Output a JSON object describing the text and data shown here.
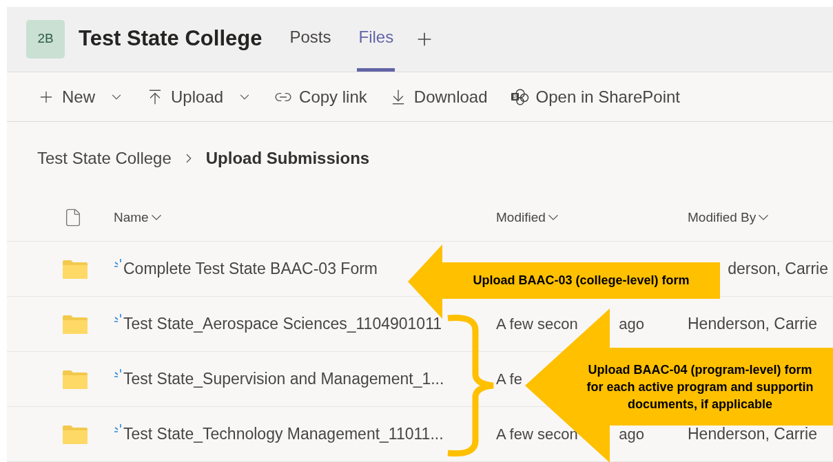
{
  "team": {
    "avatar": "2B",
    "name": "Test State College"
  },
  "tabs": [
    {
      "label": "Posts",
      "selected": false
    },
    {
      "label": "Files",
      "selected": true
    }
  ],
  "toolbar": [
    {
      "label": "New",
      "kind": "plus",
      "dropdown": true
    },
    {
      "label": "Upload",
      "kind": "upload",
      "dropdown": true
    },
    {
      "label": "Copy link",
      "kind": "link",
      "dropdown": false
    },
    {
      "label": "Download",
      "kind": "download",
      "dropdown": false
    },
    {
      "label": "Open in SharePoint",
      "kind": "sharepoint",
      "dropdown": false
    }
  ],
  "breadcrumb": [
    {
      "label": "Test State College",
      "current": false
    },
    {
      "label": "Upload Submissions",
      "current": true
    }
  ],
  "columns": [
    {
      "label": "Name"
    },
    {
      "label": "Modified"
    },
    {
      "label": "Modified By"
    }
  ],
  "rows": [
    {
      "name": "Complete Test State BAAC-03 Form",
      "modified": [],
      "modified_by": "derson, Carrie"
    },
    {
      "name": "Test State_Aerospace Sciences_1104901011",
      "modified": [
        "A few secon",
        "ago"
      ],
      "modified_by": "Henderson, Carrie"
    },
    {
      "name": "Test State_Supervision and Management_1...",
      "modified": [
        "A fe"
      ]
    },
    {
      "name": "Test State_Technology Management_11011...",
      "modified": [
        "A few secon",
        "ago"
      ],
      "modified_by": "Henderson, Carrie"
    }
  ],
  "callouts": [
    {
      "kind": "arrow",
      "lines": [
        "Upload BAAC-03 (college-level) form"
      ]
    },
    {
      "kind": "brace-arrow",
      "lines": [
        "Upload BAAC-04 (program-level) form",
        "for each active program and supportin",
        "documents, if applicable"
      ]
    }
  ]
}
